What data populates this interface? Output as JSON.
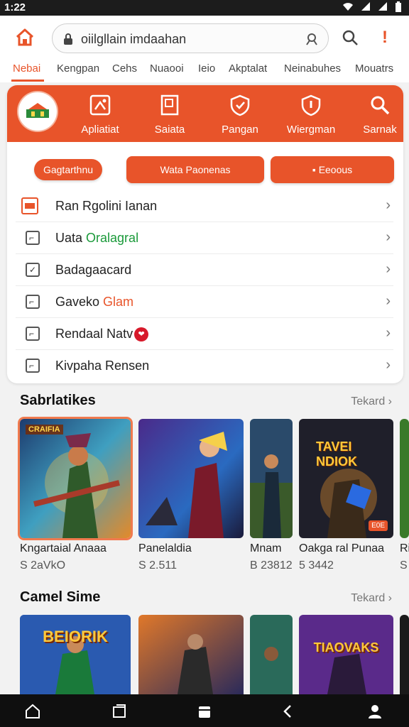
{
  "status_bar": {
    "time": "1:22"
  },
  "search": {
    "value": "oiilgllain imdaahan"
  },
  "nav_tabs": [
    {
      "label": "Nebai",
      "active": true
    },
    {
      "label": "Kengpan"
    },
    {
      "label": "Cehs"
    },
    {
      "label": "Nuaooi"
    },
    {
      "label": "Ieio"
    },
    {
      "label": "Akptalat"
    },
    {
      "label": "Neinabuhes"
    },
    {
      "label": "Mouatrs"
    }
  ],
  "categories": [
    {
      "label": "Apliatiat",
      "icon": "puzzle-icon"
    },
    {
      "label": "Saiata",
      "icon": "book-icon"
    },
    {
      "label": "Pangan",
      "icon": "shield-star-icon"
    },
    {
      "label": "Wiergman",
      "icon": "shield-icon"
    },
    {
      "label": "Sarnak",
      "icon": "search-icon"
    }
  ],
  "pills": {
    "a": "Gagtarthnu",
    "b": "Wata Paonenas",
    "c": "Eeoous"
  },
  "list": [
    {
      "label": "Ran Rgolini Ianan",
      "accent": "",
      "accent_color": ""
    },
    {
      "label": "Uata ",
      "accent": "Oralagral",
      "accent_color": "#1a9a3a"
    },
    {
      "label": "Badagaacard",
      "accent": "",
      "accent_color": ""
    },
    {
      "label": "Gaveko ",
      "accent": "Glam",
      "accent_color": "#e8542a"
    },
    {
      "label": "Rendaal Natv",
      "accent": "",
      "accent_color": ""
    },
    {
      "label": "Kivpaha Rensen",
      "accent": "",
      "accent_color": ""
    }
  ],
  "section1": {
    "title": "Sabrlatikes",
    "more": "Tekard",
    "games": [
      {
        "title": "Kngartaial Anaaa",
        "price": "S 2aVkO",
        "caption": "CRAIFIA"
      },
      {
        "title": "Panelaldia",
        "price": "S 2.511",
        "caption": ""
      },
      {
        "title": "Mnam",
        "price": "B 23812",
        "caption": ""
      },
      {
        "title": "Oakga ral Punaa",
        "price": "5 3442",
        "caption": "TAVEI NDIOK",
        "badge": "E0E"
      },
      {
        "title": "Ri",
        "price": "S",
        "caption": ""
      }
    ]
  },
  "section2": {
    "title": "Camel Sime",
    "more": "Tekard",
    "tiles": [
      {
        "text": "BEIORIK"
      },
      {
        "text": ""
      },
      {
        "text": ""
      },
      {
        "text": "TIAOVAKS"
      },
      {
        "text": ""
      }
    ]
  },
  "colors": {
    "accent": "#e8542a",
    "green": "#1a9a3a"
  }
}
